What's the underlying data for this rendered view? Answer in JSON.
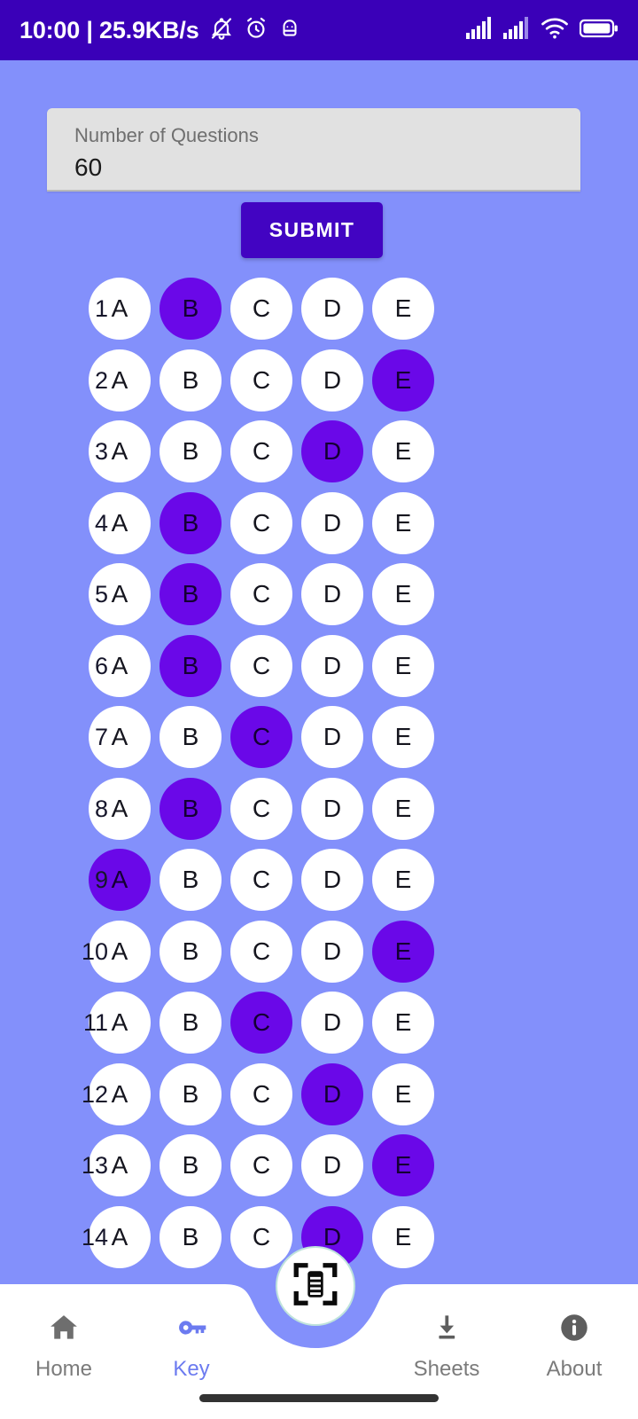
{
  "status_bar": {
    "time": "10:00",
    "separator": "|",
    "network_speed": "25.9KB/s",
    "left_icons": [
      "bell-muted-icon",
      "alarm-clock-icon",
      "android-debug-icon"
    ],
    "right_icons": [
      "signal-bars-icon",
      "signal-bars-icon",
      "wifi-icon",
      "battery-icon"
    ],
    "background_color": "#3A00B8",
    "foreground_color": "#FFFFFF"
  },
  "screen": {
    "background_color": "#8390FB",
    "accent_color": "#6A08E8"
  },
  "form": {
    "label": "Number of Questions",
    "value": "60",
    "placeholder": "Number of Questions",
    "submit_label": "SUBMIT",
    "submit_color": "#4204C2"
  },
  "answer_key": {
    "choices": [
      "A",
      "B",
      "C",
      "D",
      "E"
    ],
    "rows": [
      {
        "number": "1",
        "selected": "B"
      },
      {
        "number": "2",
        "selected": "E"
      },
      {
        "number": "3",
        "selected": "D"
      },
      {
        "number": "4",
        "selected": "B"
      },
      {
        "number": "5",
        "selected": "B"
      },
      {
        "number": "6",
        "selected": "B"
      },
      {
        "number": "7",
        "selected": "C"
      },
      {
        "number": "8",
        "selected": "B"
      },
      {
        "number": "9",
        "selected": "A"
      },
      {
        "number": "10",
        "selected": "E"
      },
      {
        "number": "11",
        "selected": "C"
      },
      {
        "number": "12",
        "selected": "D"
      },
      {
        "number": "13",
        "selected": "E"
      },
      {
        "number": "14",
        "selected": "D"
      }
    ]
  },
  "bottom_nav": {
    "items": [
      {
        "label": "Home",
        "icon": "home-icon",
        "active": false
      },
      {
        "label": "Key",
        "icon": "key-icon",
        "active": true
      },
      {
        "label": "Sheets",
        "icon": "download-icon",
        "active": false
      },
      {
        "label": "About",
        "icon": "info-icon",
        "active": false
      }
    ],
    "fab_icon": "document-scan-icon",
    "active_color": "#6C7BF0",
    "inactive_color": "#7B7B7B"
  }
}
